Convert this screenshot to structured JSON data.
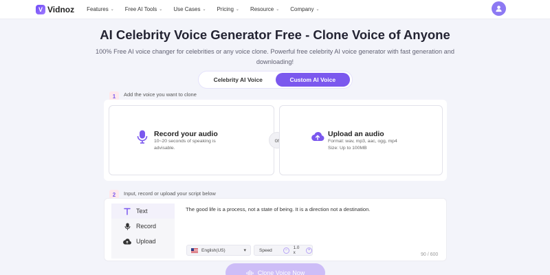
{
  "nav": {
    "logo_text": "Vidnoz",
    "items": [
      {
        "label": "Features"
      },
      {
        "label": "Free AI Tools"
      },
      {
        "label": "Use Cases"
      },
      {
        "label": "Pricing"
      },
      {
        "label": "Resource"
      },
      {
        "label": "Company"
      }
    ]
  },
  "hero": {
    "title": "AI Celebrity Voice Generator Free - Clone Voice of Anyone",
    "subtitle": "100% Free AI voice changer for celebrities or any voice clone. Powerful free celebrity AI voice generator with fast generation and downloading!"
  },
  "tabs": [
    {
      "label": "Celebrity AI Voice",
      "active": false
    },
    {
      "label": "Custom AI Voice",
      "active": true
    }
  ],
  "step1": {
    "number": "1",
    "label": "Add the voice you want to clone",
    "record": {
      "title": "Record your audio",
      "desc": "10~20 seconds of speaking is advisable."
    },
    "or": "or",
    "upload": {
      "title": "Upload an audio",
      "format": "Format: wav, mp3, aac, ogg, mp4",
      "size": "Size: Up to 100MB"
    }
  },
  "step2": {
    "number": "2",
    "label": "Input, record or upload your script below",
    "sidebar": [
      {
        "label": "Text",
        "icon": "text-icon"
      },
      {
        "label": "Record",
        "icon": "mic-icon"
      },
      {
        "label": "Upload",
        "icon": "cloud-upload-icon"
      }
    ],
    "script": "The good life is a process, not a state of being. It is a direction not a destination.",
    "language": "English(US)",
    "speed_label": "Speed",
    "speed_value": "1.0 x",
    "counter": "90 / 600"
  },
  "clone_button": "Clone Voice Now",
  "colors": {
    "accent": "#7b58ee",
    "background": "#f3f4fa",
    "button_disabled": "#cdbdf7"
  }
}
